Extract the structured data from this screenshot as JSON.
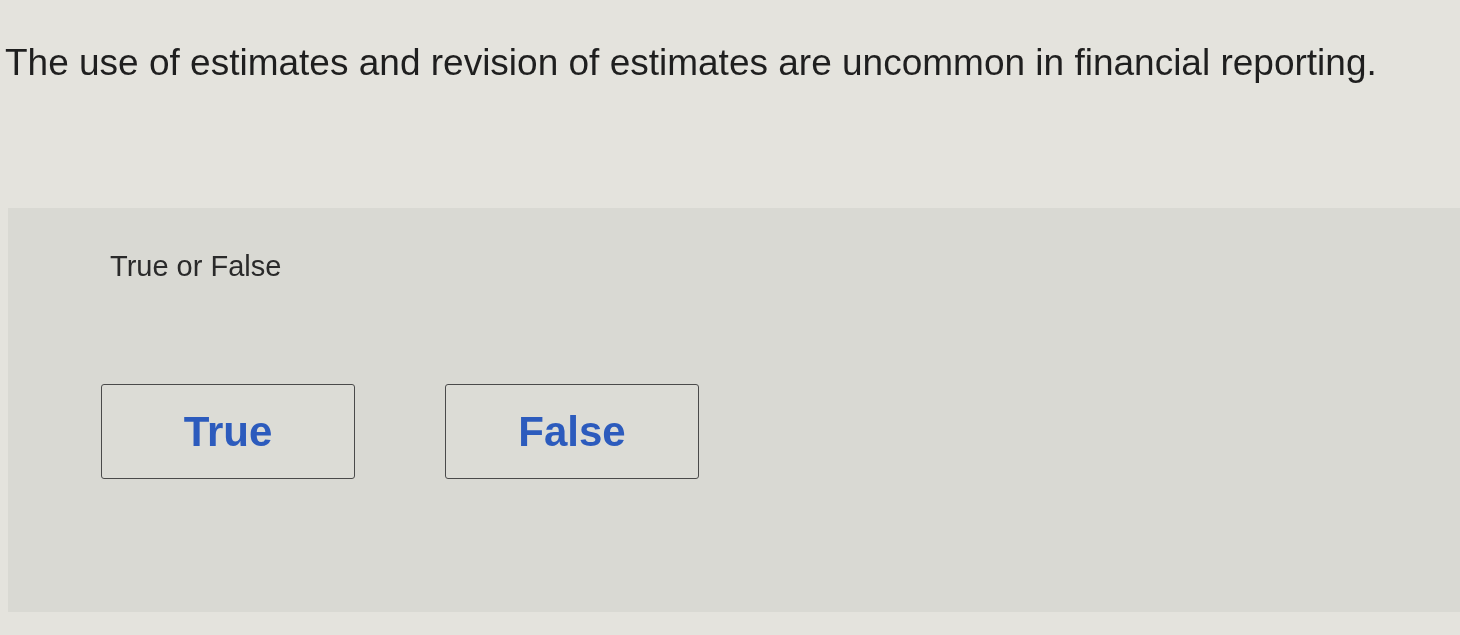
{
  "question": "The use of estimates and revision of estimates are uncommon in financial reporting.",
  "answer_panel": {
    "prompt": "True or False",
    "options": [
      {
        "label": "True",
        "selected": false
      },
      {
        "label": "False",
        "selected": false
      }
    ]
  }
}
